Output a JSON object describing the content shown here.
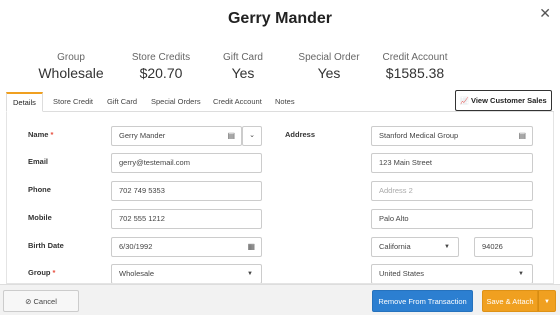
{
  "modal": {
    "title": "Gerry Mander",
    "close_icon": "close-icon"
  },
  "summary": [
    {
      "label": "Group",
      "value": "Wholesale"
    },
    {
      "label": "Store Credits",
      "value": "$20.70"
    },
    {
      "label": "Gift Card",
      "value": "Yes"
    },
    {
      "label": "Special Order",
      "value": "Yes"
    },
    {
      "label": "Credit Account",
      "value": "$1585.38"
    }
  ],
  "tabs": [
    {
      "label": "Details",
      "active": true
    },
    {
      "label": "Store Credit"
    },
    {
      "label": "Gift Card"
    },
    {
      "label": "Special Orders"
    },
    {
      "label": "Credit Account"
    },
    {
      "label": "Notes"
    }
  ],
  "view_customer_sales": {
    "label": "View Customer Sales",
    "icon": "line-chart-icon"
  },
  "form": {
    "name": {
      "label": "Name",
      "value": "Gerry Mander",
      "required": "*"
    },
    "email": {
      "label": "Email",
      "value": "gerry@testemail.com"
    },
    "phone": {
      "label": "Phone",
      "value": "702 749 5353"
    },
    "mobile": {
      "label": "Mobile",
      "value": "702 555 1212"
    },
    "birth_date": {
      "label": "Birth Date",
      "value": "6/30/1992"
    },
    "group": {
      "label": "Group",
      "value": "Wholesale",
      "required": "*"
    },
    "address": {
      "label": "Address",
      "company": "Stanford Medical Group",
      "line1": "123 Main Street",
      "line2_placeholder": "Address 2",
      "city": "Palo Alto",
      "state": "California",
      "zip": "94026",
      "country": "United States"
    }
  },
  "footer": {
    "cancel_label": "Cancel",
    "remove_label": "Remove From Transaction",
    "save_label": "Save & Attach"
  },
  "colors": {
    "accent": "#f0a020",
    "primary": "#2c7fd1",
    "required": "#e74c3c"
  }
}
